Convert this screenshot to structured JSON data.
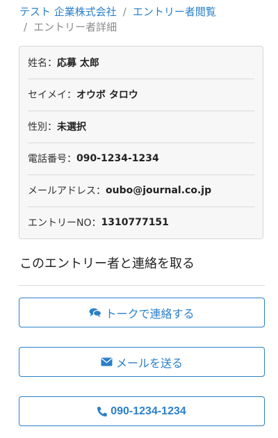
{
  "breadcrumb": {
    "company": "テスト 企業株式会社",
    "separator": "/",
    "entries": "エントリー者閲覧",
    "current": "エントリー者詳細"
  },
  "profile": {
    "rows": [
      {
        "label": "姓名：",
        "value": "応募 太郎"
      },
      {
        "label": "セイメイ：",
        "value": "オウボ タロウ"
      },
      {
        "label": "性別：",
        "value": "未選択"
      },
      {
        "label": "電話番号：",
        "value": "090-1234-1234"
      },
      {
        "label": "メールアドレス：",
        "value": "oubo@journal.co.jp"
      },
      {
        "label": "エントリーNO：",
        "value": "1310777151"
      }
    ]
  },
  "contact": {
    "heading": "このエントリー者と連絡を取る",
    "talk_button": {
      "label": "トークで連絡する",
      "icon": "comments-icon"
    },
    "mail_button": {
      "label": "メールを送る",
      "icon": "envelope-icon"
    },
    "phone_button": {
      "label": "090-1234-1234",
      "icon": "phone-icon"
    }
  },
  "colors": {
    "accent": "#2a7fc9",
    "muted_text": "#8a8a8a",
    "card_background": "#f7f7f7",
    "card_border": "#d6d6d6"
  }
}
